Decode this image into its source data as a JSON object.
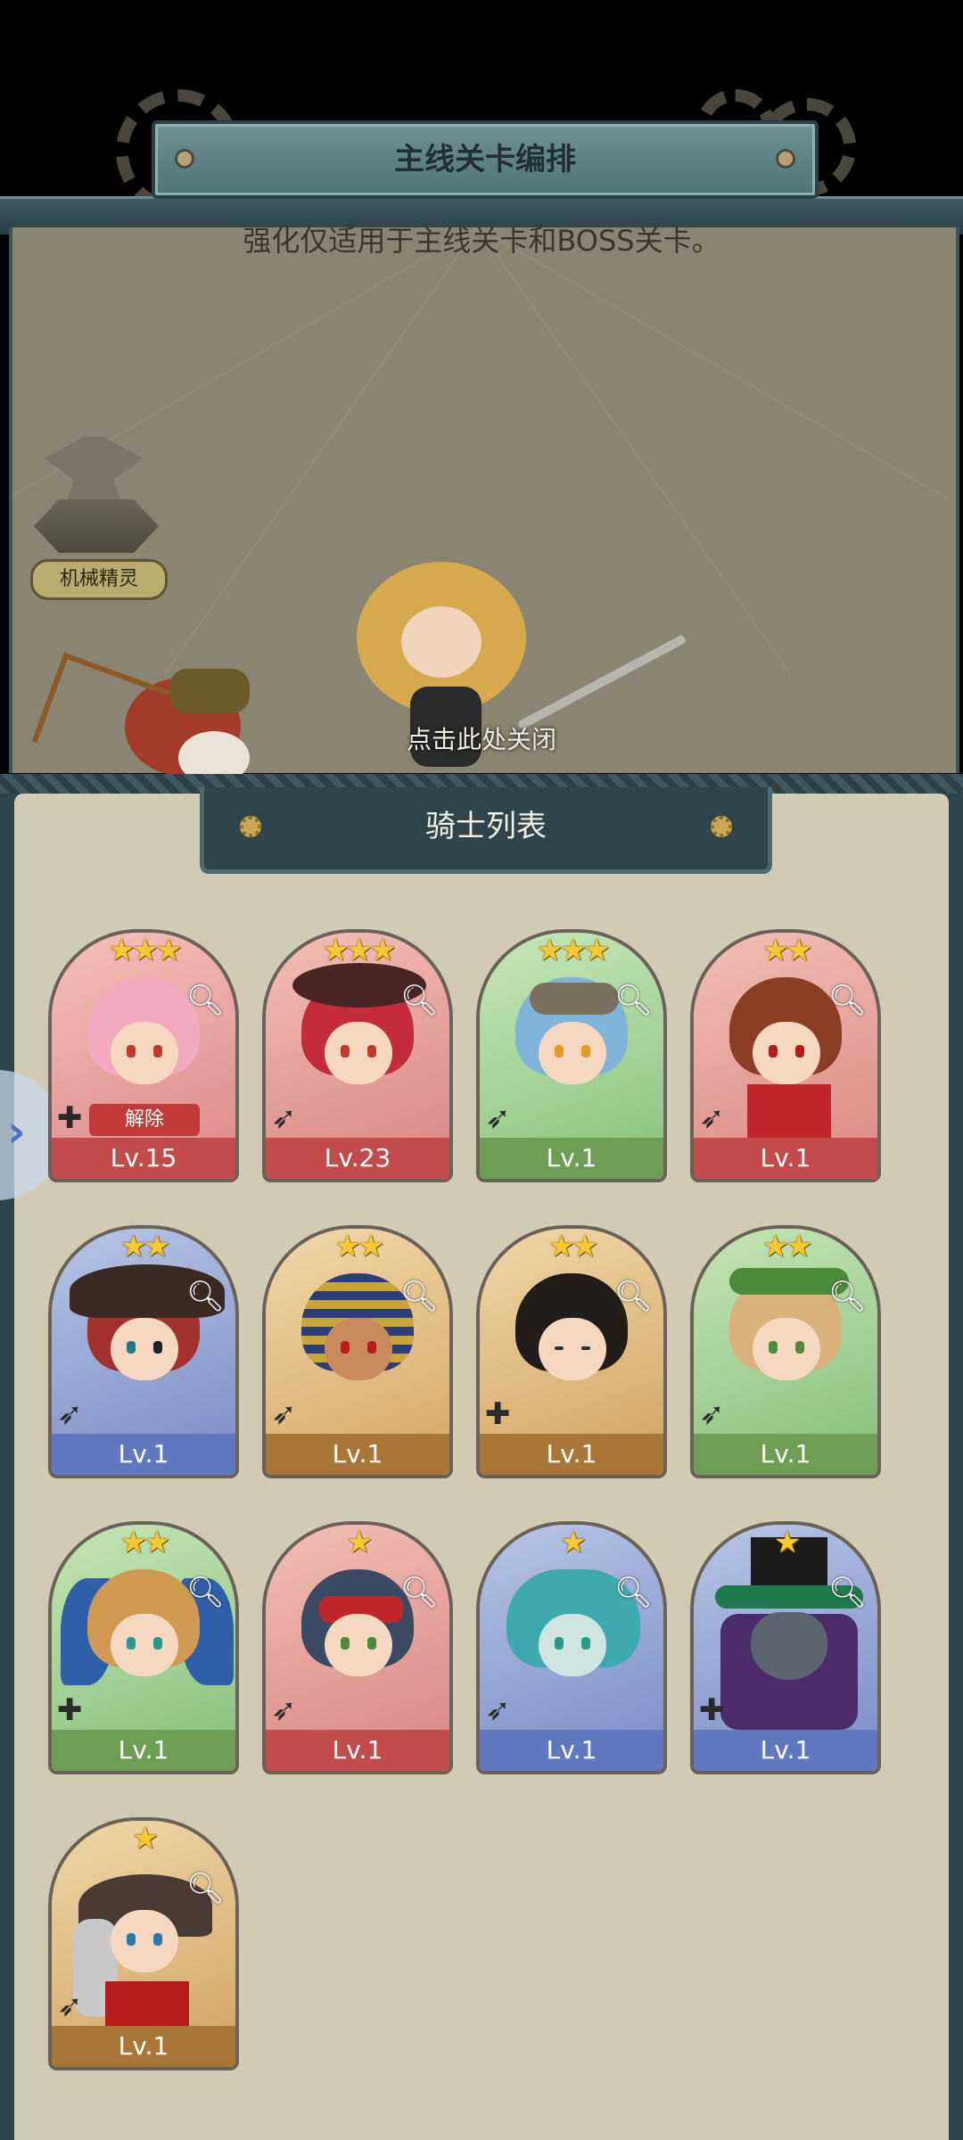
{
  "header": {
    "title": "主线关卡编排",
    "subtitle": "强化仅适用于主线关卡和BOSS关卡。",
    "spirit_label": "机械精灵",
    "close_hint": "点击此处关闭"
  },
  "list": {
    "title": "骑士列表",
    "side_arrow": "›"
  },
  "knights": [
    {
      "level": "Lv.15",
      "stars": "★★★",
      "role_icon": "plus-icon",
      "remove_label": "解除"
    },
    {
      "level": "Lv.23",
      "stars": "★★★",
      "role_icon": "bow-icon"
    },
    {
      "level": "Lv.1",
      "stars": "★★★",
      "role_icon": "bow-icon"
    },
    {
      "level": "Lv.1",
      "stars": "★★",
      "role_icon": "bow-icon"
    },
    {
      "level": "Lv.1",
      "stars": "★★",
      "role_icon": "bow-icon"
    },
    {
      "level": "Lv.1",
      "stars": "★★",
      "role_icon": "bow-icon"
    },
    {
      "level": "Lv.1",
      "stars": "★★",
      "role_icon": "plus-icon"
    },
    {
      "level": "Lv.1",
      "stars": "★★",
      "role_icon": "bow-icon"
    },
    {
      "level": "Lv.1",
      "stars": "★★",
      "role_icon": "plus-icon"
    },
    {
      "level": "Lv.1",
      "stars": "★",
      "role_icon": "bow-icon"
    },
    {
      "level": "Lv.1",
      "stars": "★",
      "role_icon": "bow-icon"
    },
    {
      "level": "Lv.1",
      "stars": "★",
      "role_icon": "plus-icon"
    },
    {
      "level": "Lv.1",
      "stars": "★",
      "role_icon": "bow-icon"
    }
  ],
  "colors": {
    "red": "#c24b4b",
    "green": "#6e9e55",
    "blue": "#5f78bf",
    "brown": "#a87636",
    "panel": "#d2cbb3",
    "frame": "#2f454b"
  }
}
